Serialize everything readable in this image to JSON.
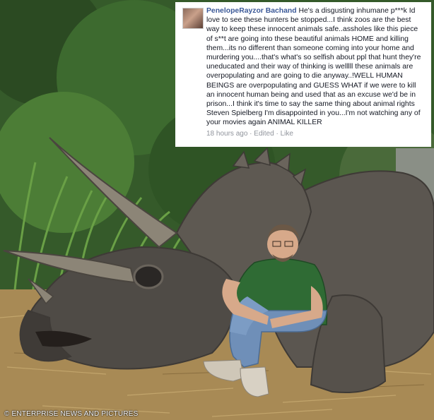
{
  "comment": {
    "author": "PenelopeRayzor Bachand",
    "body": "He's a disgusting inhumane p***k Id love to see these hunters be stopped...I think zoos are the best way to keep these innocent animals safe..assholes like this piece of s**t are going into these beautiful animals HOME and killing them...its no different than someone coming into your home and murdering you....that's what's so selfish about ppl that hunt they're uneducated and their way of thinking is welllll these animals are overpopulating and are going to die anyway..!WELL HUMAN BEINGS are overpopulating and GUESS WHAT if we were to kill an innocent human being and used that as an excuse we'd be in prison...I think it's time to say the same thing about animal rights Steven Spielberg I'm disappointed in you...I'm not watching any of your movies again ANIMAL KILLER",
    "timestamp": "18 hours ago",
    "separator": "·",
    "edited": "Edited",
    "like": "Like"
  },
  "watermark": "© ENTERPRISE NEWS AND PICTURES",
  "colors": {
    "author_link": "#3b5998",
    "meta_gray": "#90949c",
    "shirt_green": "#2f6b34",
    "jeans_blue": "#6f8fb8",
    "dino_gray": "#5b5650"
  }
}
